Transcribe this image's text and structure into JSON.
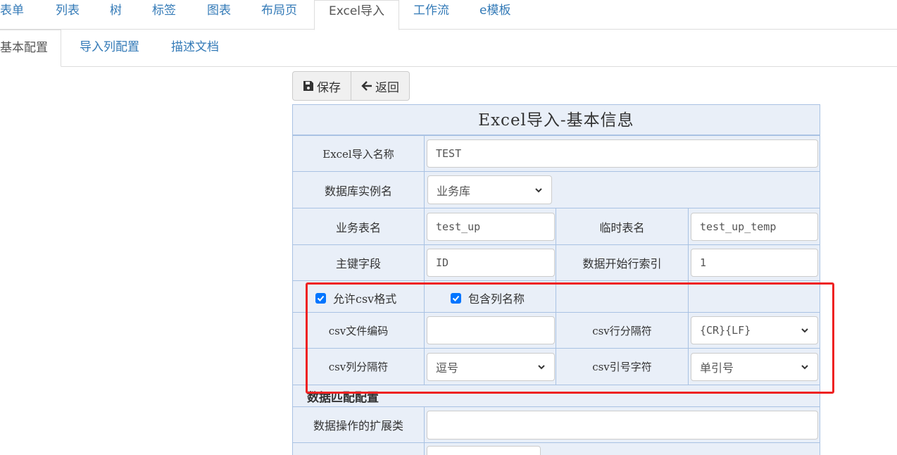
{
  "top_tabs": [
    "表单",
    "列表",
    "树",
    "标签",
    "图表",
    "布局页",
    "Excel导入",
    "工作流",
    "e模板"
  ],
  "sub_tabs": [
    "基本配置",
    "导入列配置",
    "描述文档"
  ],
  "toolbar": {
    "save_label": "保存",
    "back_label": "返回"
  },
  "form": {
    "title": "Excel导入-基本信息",
    "import_name_label": "Excel导入名称",
    "import_name_value": "TEST",
    "db_instance_label": "数据库实例名",
    "db_instance_value": "业务库",
    "biz_table_label": "业务表名",
    "biz_table_value": "test_up",
    "temp_table_label": "临时表名",
    "temp_table_value": "test_up_temp",
    "pk_label": "主键字段",
    "pk_value": "ID",
    "start_row_label": "数据开始行索引",
    "start_row_value": "1",
    "allow_csv_label": "允许csv格式",
    "include_header_label": "包含列名称",
    "csv_encoding_label": "csv文件编码",
    "csv_encoding_value": "",
    "csv_row_sep_label": "csv行分隔符",
    "csv_row_sep_value": "{CR}{LF}",
    "csv_col_sep_label": "csv列分隔符",
    "csv_col_sep_value": "逗号",
    "csv_quote_label": "csv引号字符",
    "csv_quote_value": "单引号",
    "match_section": "数据匹配配置",
    "ext_class_label": "数据操作的扩展类",
    "ext_class_value": ""
  },
  "colors": {
    "link": "#337ab7",
    "table_bg": "#e9eff8",
    "table_border": "#a9c2e3",
    "highlight": "#ee2222",
    "checkbox": "#0075ff"
  }
}
